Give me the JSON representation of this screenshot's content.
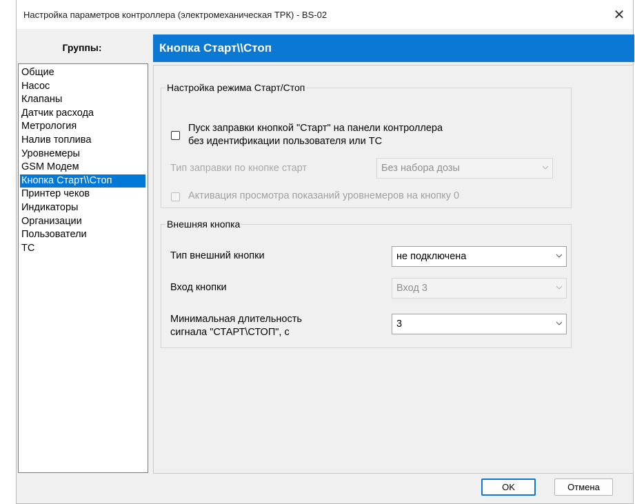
{
  "window": {
    "title": "Настройка параметров контроллера (электромеханическая ТРК) - BS-02",
    "close_symbol": "✕"
  },
  "groups": {
    "header": "Группы:",
    "items": [
      "Общие",
      "Насос",
      "Клапаны",
      "Датчик расхода",
      "Метрология",
      "Налив топлива",
      "Уровнемеры",
      "GSM Модем",
      "Кнопка Старт\\\\Стоп",
      "Принтер чеков",
      "Индикаторы",
      "Организации",
      "Пользователи",
      "ТС"
    ],
    "selected_index": 8
  },
  "section": {
    "title": "Кнопка Старт\\\\Стоп"
  },
  "start_stop_mode": {
    "legend": "Настройка режима Старт/Стоп",
    "start_without_id": {
      "label_line1": "Пуск заправки кнопкой \"Старт\" на панели контроллера",
      "label_line2": "без идентификации пользователя или ТС",
      "checked": false
    },
    "fueling_type": {
      "label": "Тип заправки по кнопке старт",
      "value": "Без набора дозы",
      "enabled": false
    },
    "level_view_activation": {
      "label": "Активация просмотра показаний уровнемеров на кнопку 0",
      "checked": false,
      "enabled": false
    }
  },
  "external_button": {
    "legend": "Внешняя кнопка",
    "type": {
      "label": "Тип внешний кнопки",
      "value": "не подключена"
    },
    "input": {
      "label": "Вход кнопки",
      "value": "Вход 3",
      "enabled": false
    },
    "min_duration": {
      "label_line1": "Минимальная длительность",
      "label_line2": "сигнала \"СТАРТ\\СТОП\", с",
      "value": "3"
    }
  },
  "buttons": {
    "ok": "OK",
    "cancel": "Отмена"
  },
  "colors": {
    "accent": "#0a78d4",
    "selection": "#0078d7",
    "window_bg": "#f0f0f0"
  }
}
